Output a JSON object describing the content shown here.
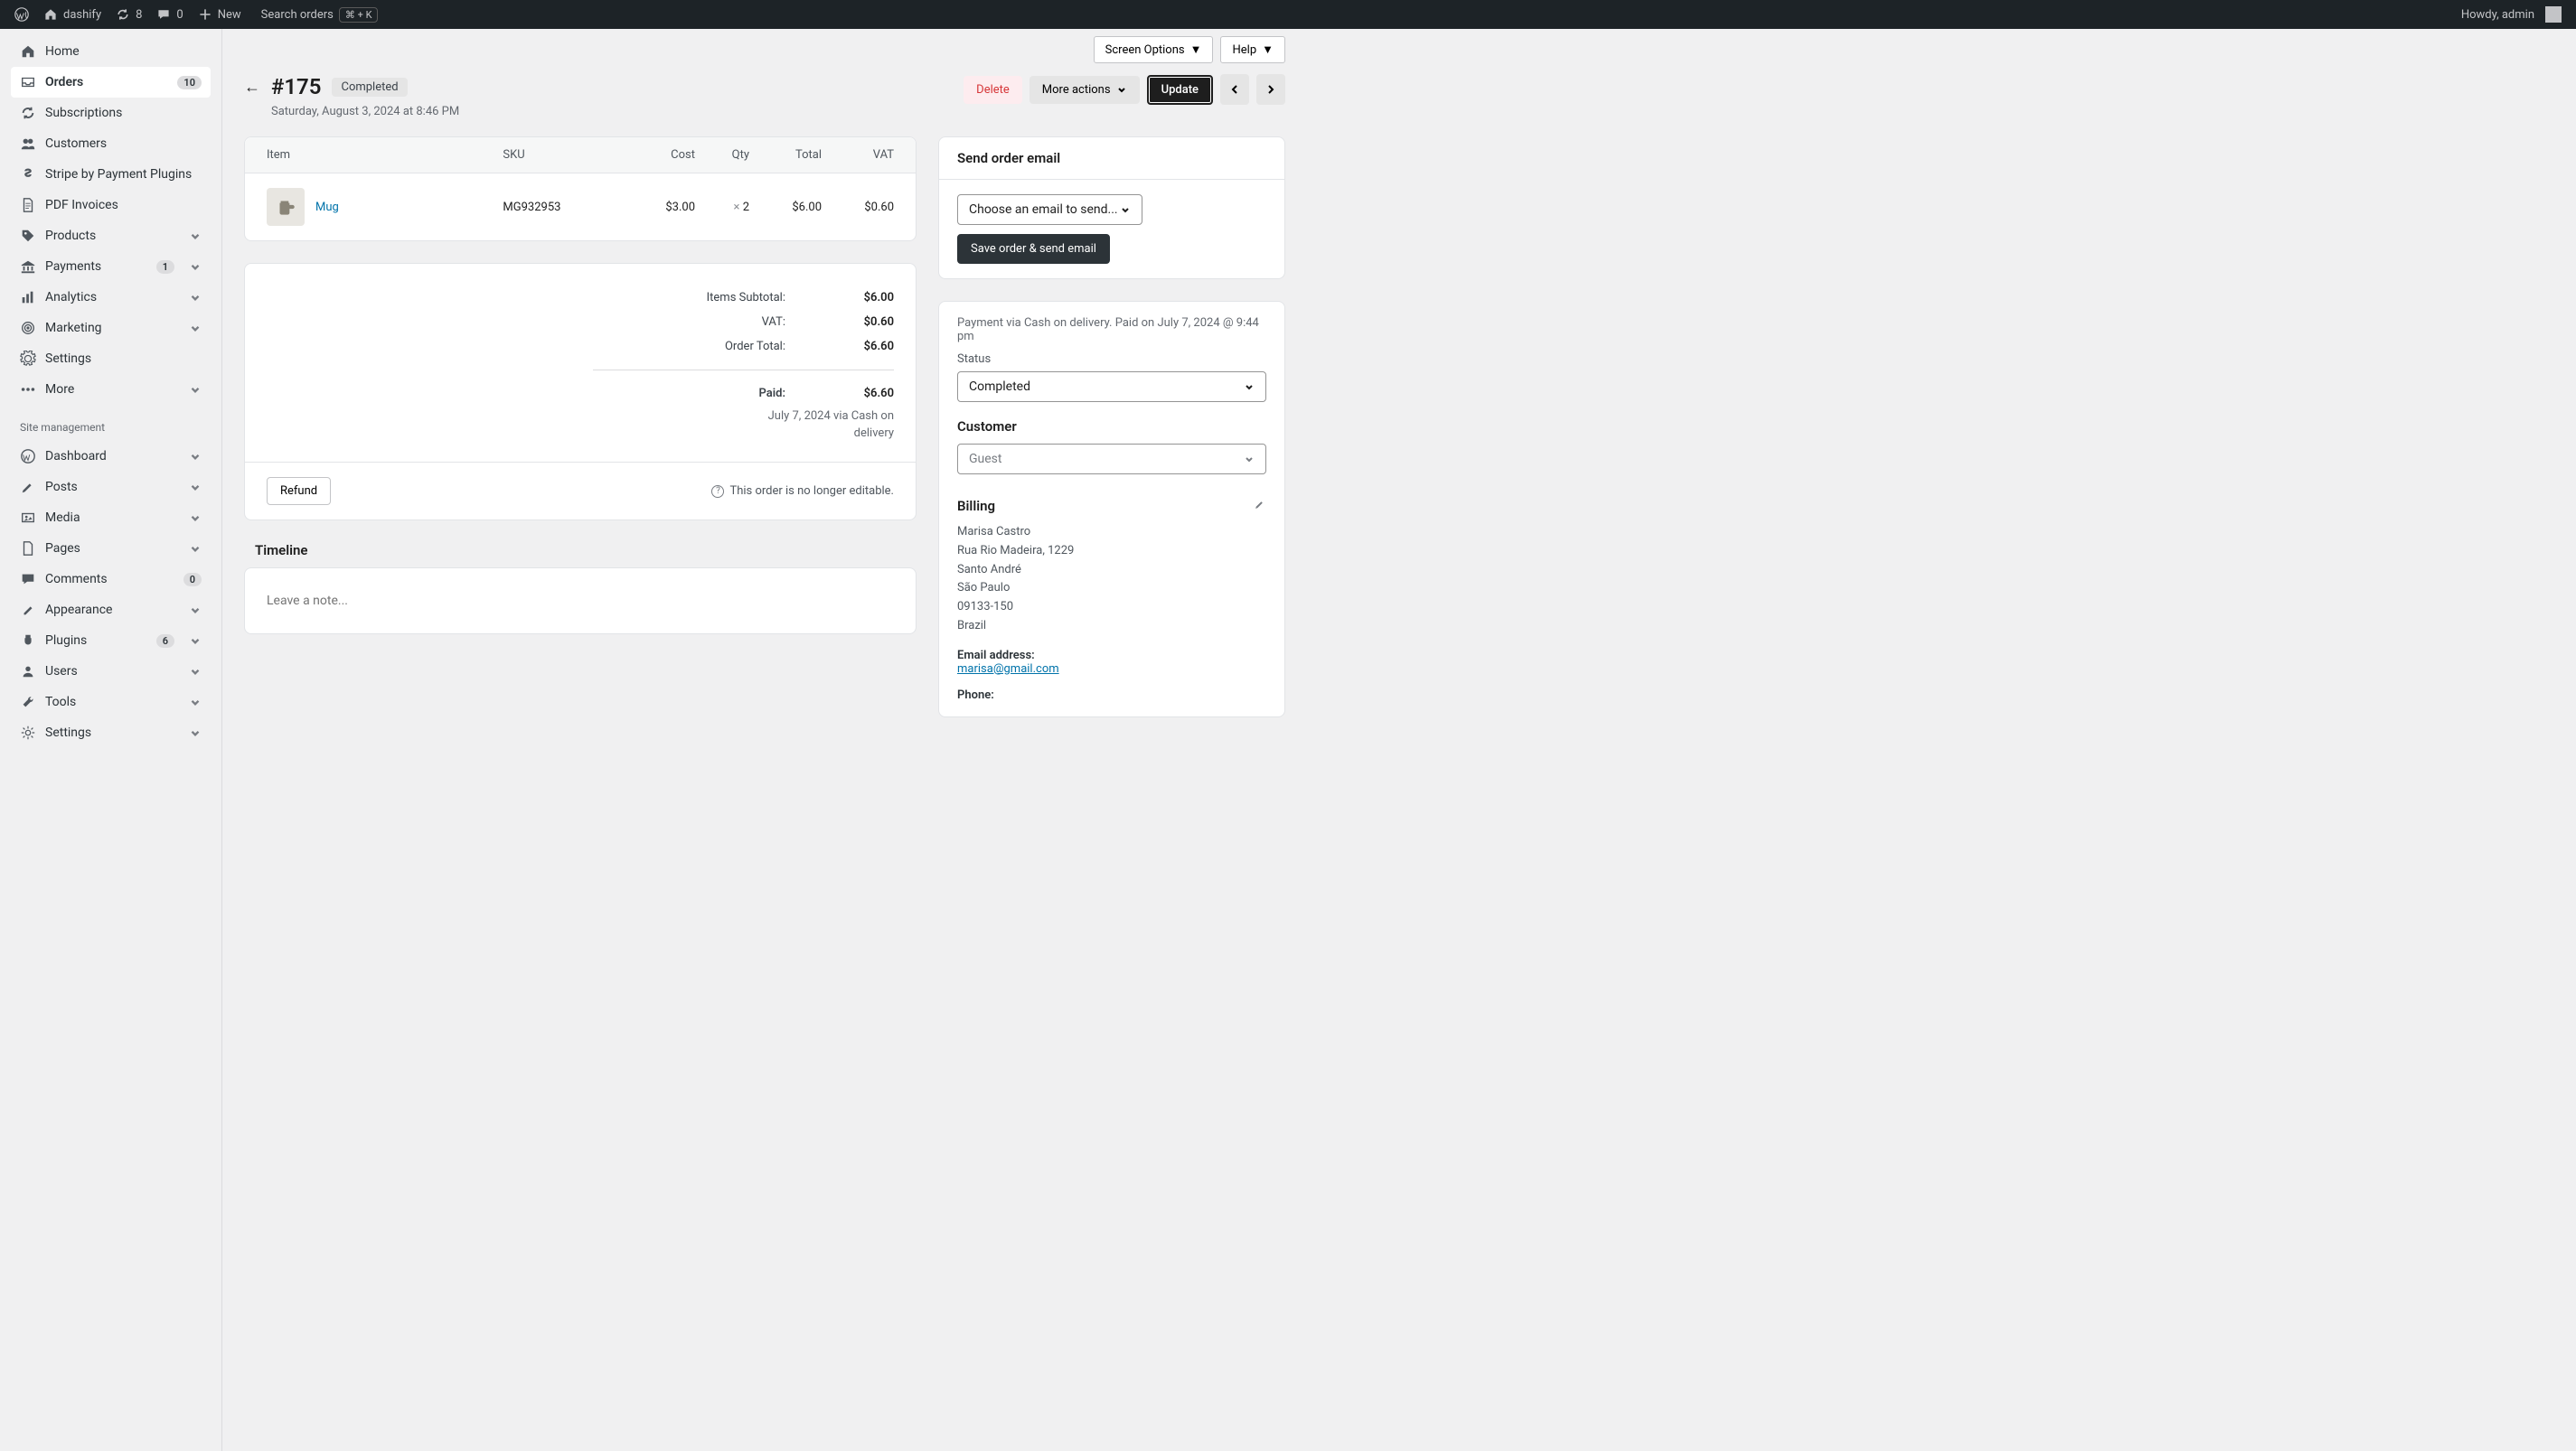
{
  "adminbar": {
    "site": "dashify",
    "updates": "8",
    "comments": "0",
    "new": "New",
    "search": "Search orders",
    "shortcut": "⌘ + K",
    "howdy": "Howdy, admin"
  },
  "sidebar": {
    "items": [
      {
        "label": "Home"
      },
      {
        "label": "Orders",
        "count": "10",
        "active": true
      },
      {
        "label": "Subscriptions"
      },
      {
        "label": "Customers"
      },
      {
        "label": "Stripe by Payment Plugins"
      },
      {
        "label": "PDF Invoices"
      },
      {
        "label": "Products",
        "chev": true
      },
      {
        "label": "Payments",
        "count": "1",
        "chev": true
      },
      {
        "label": "Analytics",
        "chev": true
      },
      {
        "label": "Marketing",
        "chev": true
      },
      {
        "label": "Settings"
      },
      {
        "label": "More",
        "chev": true
      }
    ],
    "heading": "Site management",
    "mgmt": [
      {
        "label": "Dashboard",
        "chev": true
      },
      {
        "label": "Posts",
        "chev": true
      },
      {
        "label": "Media",
        "chev": true
      },
      {
        "label": "Pages",
        "chev": true
      },
      {
        "label": "Comments",
        "count": "0"
      },
      {
        "label": "Appearance",
        "chev": true
      },
      {
        "label": "Plugins",
        "count": "6",
        "chev": true
      },
      {
        "label": "Users",
        "chev": true
      },
      {
        "label": "Tools",
        "chev": true
      },
      {
        "label": "Settings",
        "chev": true
      }
    ]
  },
  "topctl": {
    "screen": "Screen Options",
    "help": "Help"
  },
  "order": {
    "number": "#175",
    "status": "Completed",
    "date": "Saturday, August 3, 2024 at 8:46 PM",
    "actions": {
      "delete": "Delete",
      "more": "More actions",
      "update": "Update"
    }
  },
  "items": {
    "head": {
      "item": "Item",
      "sku": "SKU",
      "cost": "Cost",
      "qty": "Qty",
      "total": "Total",
      "vat": "VAT"
    },
    "rows": [
      {
        "name": "Mug",
        "sku": "MG932953",
        "cost": "$3.00",
        "qty_x": "×",
        "qty": "2",
        "total": "$6.00",
        "vat": "$0.60"
      }
    ]
  },
  "totals": {
    "subtotal_l": "Items Subtotal:",
    "subtotal_v": "$6.00",
    "vat_l": "VAT:",
    "vat_v": "$0.60",
    "order_l": "Order Total:",
    "order_v": "$6.60",
    "paid_l": "Paid:",
    "paid_v": "$6.60",
    "paid_sub1": "July 7, 2024 via Cash on",
    "paid_sub2": "delivery",
    "refund": "Refund",
    "note": "This order is no longer editable."
  },
  "timeline": {
    "title": "Timeline",
    "placeholder": "Leave a note..."
  },
  "right": {
    "send_title": "Send order email",
    "email_select": "Choose an email to send...",
    "send_btn": "Save order & send email",
    "payment_meta": "Payment via Cash on delivery. Paid on July 7, 2024 @ 9:44 pm",
    "status_l": "Status",
    "status_v": "Completed",
    "customer_h": "Customer",
    "customer_v": "Guest",
    "billing_h": "Billing",
    "addr": [
      "Marisa Castro",
      "Rua Rio Madeira, 1229",
      "Santo André",
      "São Paulo",
      "09133-150",
      "Brazil"
    ],
    "email_l": "Email address:",
    "email_v": "marisa@gmail.com",
    "phone_l": "Phone:"
  }
}
